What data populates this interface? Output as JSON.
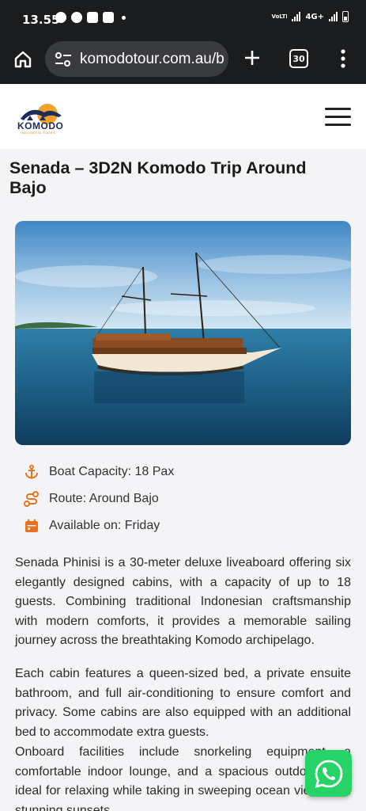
{
  "status_bar": {
    "time": "13.55",
    "network_label": "4G+",
    "volte_label": "VoLTE"
  },
  "browser": {
    "url": "komodotour.com.au/b",
    "tab_count": "30"
  },
  "site": {
    "logo_text": "KOMODO",
    "logo_subtext": "INDONESIA TOURS"
  },
  "page": {
    "title": "Senada – 3D2N Komodo Trip Around Bajo",
    "features": [
      {
        "icon": "anchor-icon",
        "label": "Boat Capacity: 18 Pax"
      },
      {
        "icon": "route-icon",
        "label": "Route: Around Bajo"
      },
      {
        "icon": "calendar-icon",
        "label": "Available on: Friday"
      }
    ],
    "paragraphs": [
      "Senada Phinisi is a 30-meter deluxe liveaboard offering six elegantly designed cabins, with a capacity of up to 18 guests. Combining traditional Indonesian craftsmanship with modern comforts, it provides a memorable sailing journey across the breathtaking Komodo archipelago.",
      "Each cabin features a queen-sized bed, a private ensuite bathroom, and full air-conditioning to ensure comfort and privacy. Some cabins are also equipped with an additional bed to accommodate extra guests.",
      "Onboard facilities include snorkeling equipment, a comfortable indoor lounge, and a spacious outdoor deck ideal for relaxing while taking in sweeping ocean views and stunning sunsets."
    ]
  },
  "colors": {
    "accent_orange": "#e8731e",
    "whatsapp_green": "#25d366",
    "chrome_dark": "#1b1c1e"
  }
}
